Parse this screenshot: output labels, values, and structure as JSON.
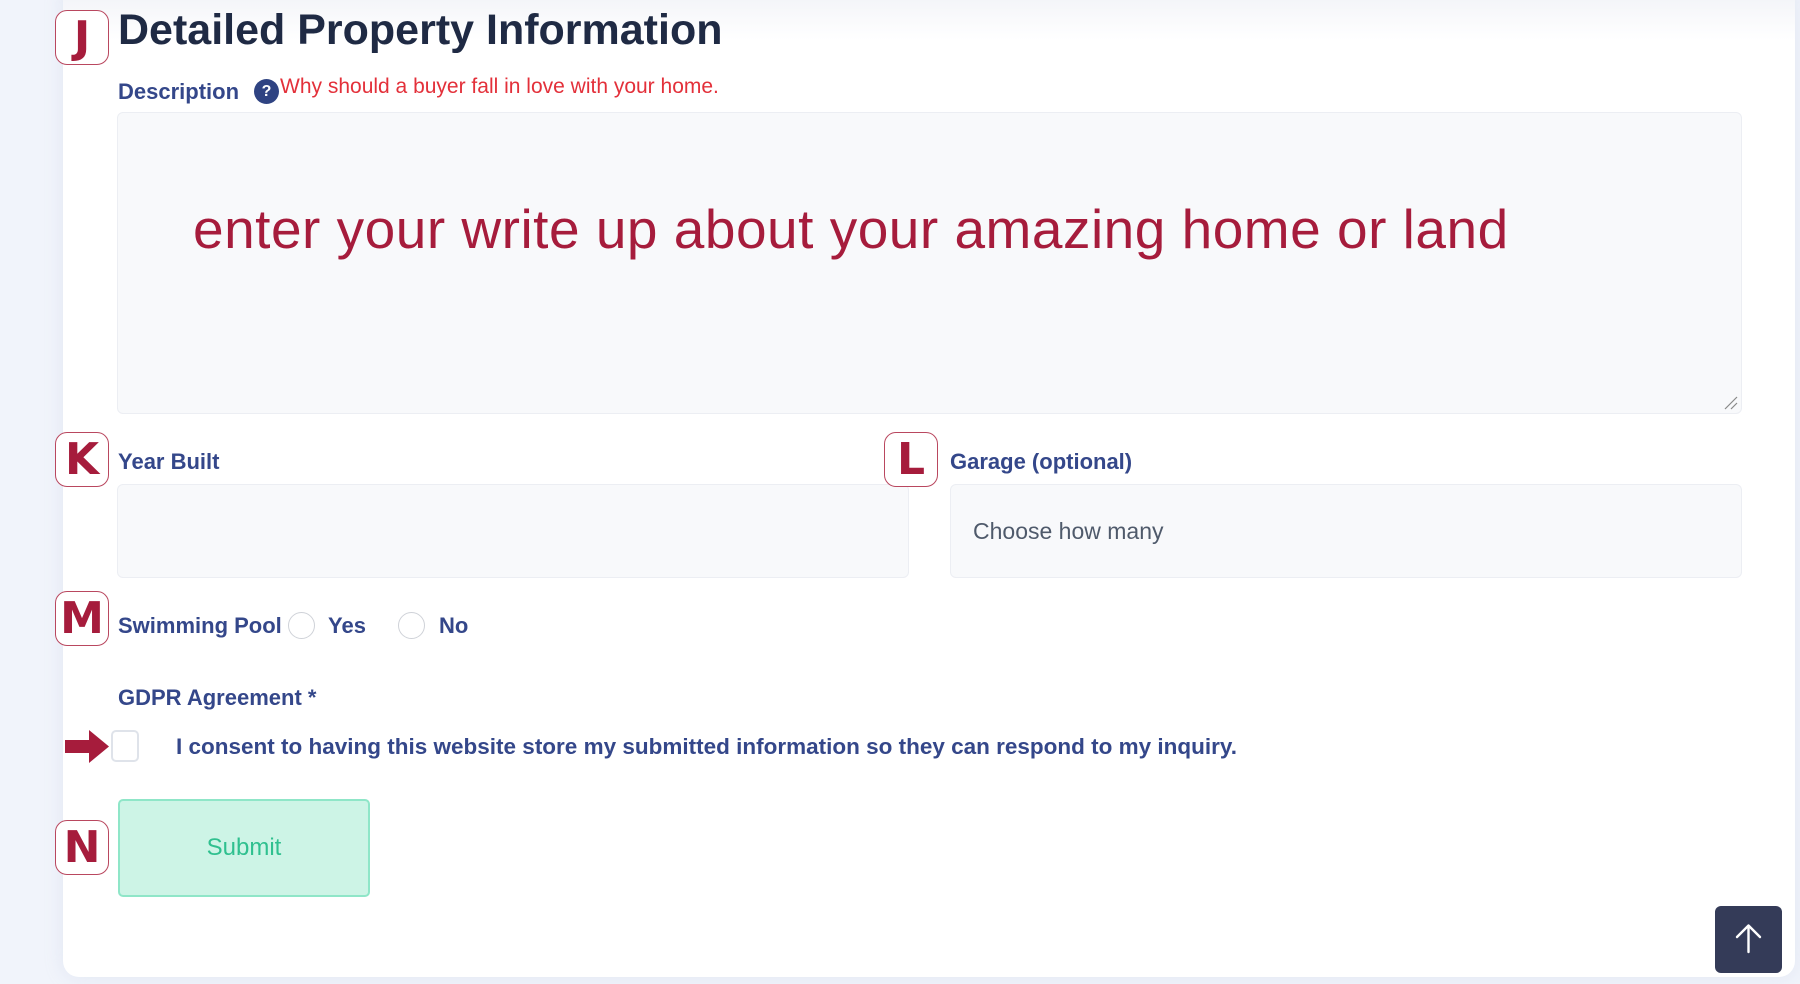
{
  "section": {
    "title": "Detailed Property Information"
  },
  "badges": {
    "j": "J",
    "k": "K",
    "l": "L",
    "m": "M",
    "n": "N"
  },
  "description": {
    "label": "Description",
    "help_icon": "?",
    "help_text": "Why should a buyer fall in love with your home.",
    "placeholder": "enter your write up about your amazing home or land",
    "value": ""
  },
  "year_built": {
    "label": "Year Built",
    "value": "",
    "placeholder": ""
  },
  "garage": {
    "label": "Garage (optional)",
    "selected": "Choose how many"
  },
  "swimming_pool": {
    "label": "Swimming Pool",
    "options": [
      {
        "label": "Yes",
        "checked": false
      },
      {
        "label": "No",
        "checked": false
      }
    ]
  },
  "gdpr": {
    "label": "GDPR Agreement *",
    "consent_text": "I consent to having this website store my submitted information so they can respond to my inquiry.",
    "checked": false
  },
  "submit": {
    "label": "Submit"
  },
  "colors": {
    "annotation": "#a61c3c",
    "label": "#34478a",
    "title": "#1f2a44",
    "help": "#e3303a",
    "submit_bg": "#cdf4e6",
    "submit_text": "#2fc08f",
    "scroll_top_bg": "#343b58"
  },
  "scroll_top": {
    "icon": "arrow-up-icon"
  }
}
